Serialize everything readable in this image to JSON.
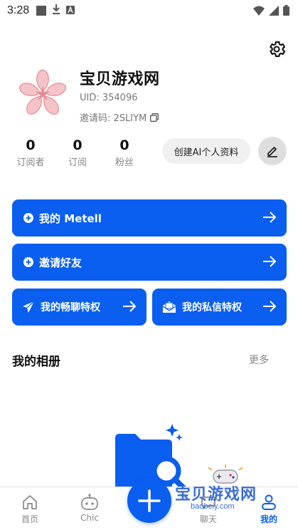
{
  "status_bar": {
    "time": "3:28"
  },
  "profile": {
    "name": "宝贝游戏网",
    "uid": "UID: 354096",
    "invite_code": "邀请码: 2SLIYM"
  },
  "stats": [
    {
      "value": "0",
      "label": "订阅者"
    },
    {
      "value": "0",
      "label": "订阅"
    },
    {
      "value": "0",
      "label": "粉丝"
    }
  ],
  "create_ai_label": "创建AI个人资料",
  "cards": {
    "metell": "我的 Metell",
    "invite_friends": "邀请好友",
    "chat_privilege": "我的畅聊特权",
    "message_privilege": "我的私信特权"
  },
  "album": {
    "title": "我的相册",
    "more": "更多"
  },
  "tabs": [
    {
      "label": "首页"
    },
    {
      "label": "Chic"
    },
    {
      "label": "聊天"
    },
    {
      "label": "我的"
    }
  ],
  "watermark": {
    "title": "宝贝游戏网",
    "url": "baobeiy.com"
  },
  "colors": {
    "accent": "#0a5ef0",
    "avatar_pink": "#f6c3c8"
  }
}
